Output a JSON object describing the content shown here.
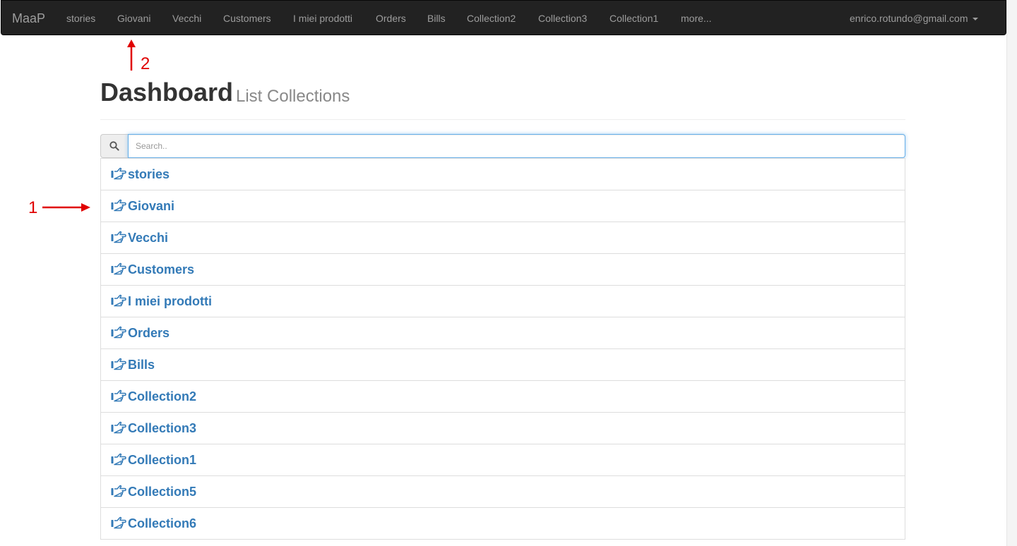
{
  "navbar": {
    "brand": "MaaP",
    "links": [
      "stories",
      "Giovani",
      "Vecchi",
      "Customers",
      "I miei prodotti",
      "Orders",
      "Bills",
      "Collection2",
      "Collection3",
      "Collection1",
      "more..."
    ],
    "user": "enrico.rotundo@gmail.com"
  },
  "header": {
    "title": "Dashboard",
    "subtitle": "List Collections"
  },
  "search": {
    "placeholder": "Search.."
  },
  "collections": [
    "stories",
    "Giovani",
    "Vecchi",
    "Customers",
    "I miei prodotti",
    "Orders",
    "Bills",
    "Collection2",
    "Collection3",
    "Collection1",
    "Collection5",
    "Collection6"
  ],
  "annotations": {
    "one": "1",
    "two": "2"
  },
  "colors": {
    "navbar_bg": "#222222",
    "nav_text": "#9d9d9d",
    "link": "#337ab7",
    "annotation": "#e00000"
  },
  "icons": {
    "search": "search-icon",
    "list_item": "hand-pointing-right-icon",
    "user_menu": "caret-down-icon"
  }
}
